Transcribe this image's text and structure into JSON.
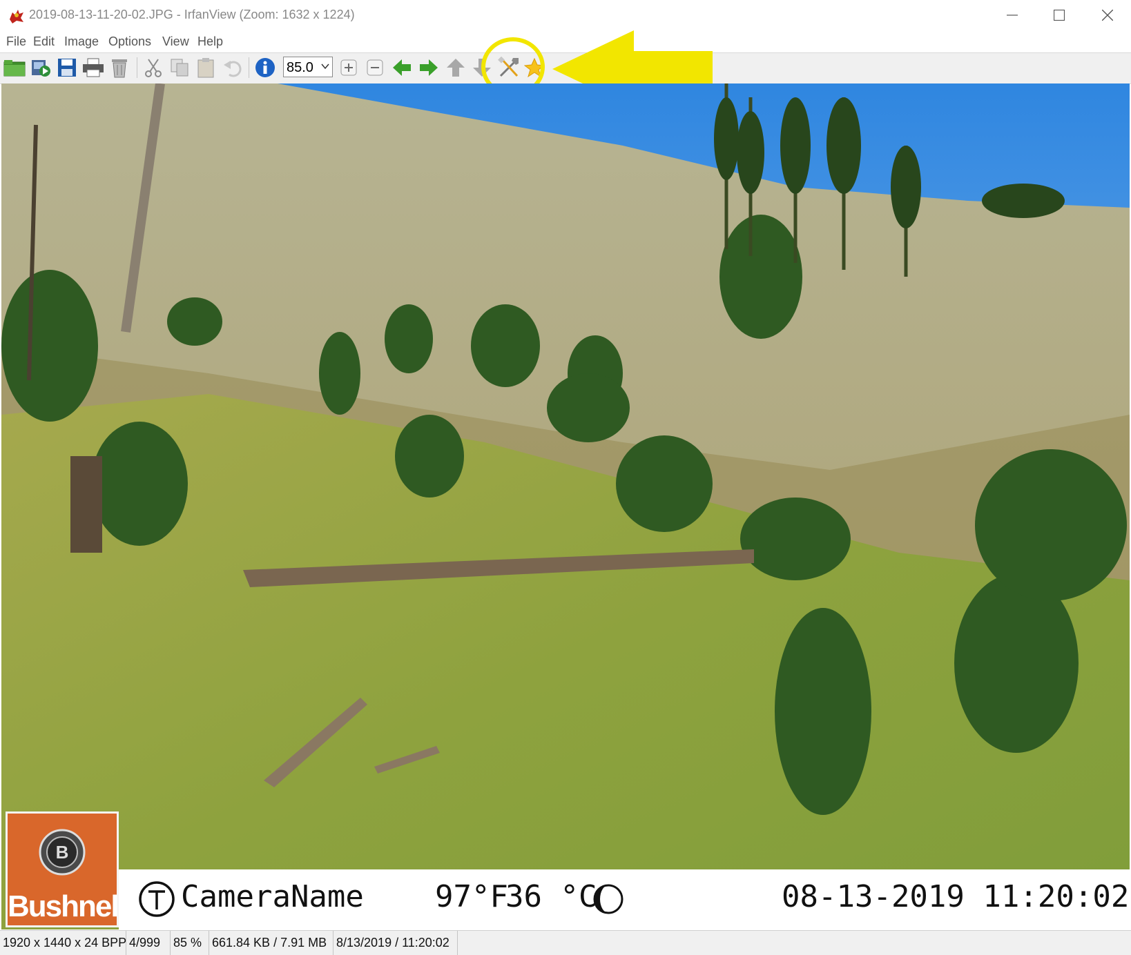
{
  "window": {
    "title": "2019-08-13-11-20-02.JPG - IrfanView (Zoom: 1632 x 1224)",
    "icon": "irfanview-red-cat-icon",
    "controls": [
      "minimize-icon",
      "maximize-icon",
      "close-icon"
    ]
  },
  "menu": {
    "file": "File",
    "edit": "Edit",
    "image": "Image",
    "options": "Options",
    "view": "View",
    "help": "Help"
  },
  "toolbar": {
    "zoom_value": "85.0",
    "buttons": [
      "open-folder-icon",
      "slideshow-icon",
      "save-icon",
      "print-icon",
      "delete-icon",
      "cut-icon",
      "copy-icon",
      "paste-icon",
      "undo-icon",
      "info-icon",
      "zoom-in-icon",
      "zoom-out-icon",
      "previous-arrow-icon",
      "next-arrow-icon",
      "up-arrow-icon",
      "down-arrow-icon",
      "properties-tools-icon",
      "favorites-star-icon"
    ],
    "highlight_color": "#f2e600"
  },
  "photo": {
    "camera_name": "CameraName",
    "temp_f": "97°F",
    "temp_c": "36 °C",
    "datetime": "08-13-2019 11:20:02",
    "brand": "Bushnell",
    "brand_color": "#d9672b"
  },
  "status": {
    "dimensions": "1920 x 1440 x 24 BPP",
    "index": "4/999",
    "zoom": "85 %",
    "size": "661.84 KB / 7.91 MB",
    "date": "8/13/2019 / 11:20:02"
  }
}
